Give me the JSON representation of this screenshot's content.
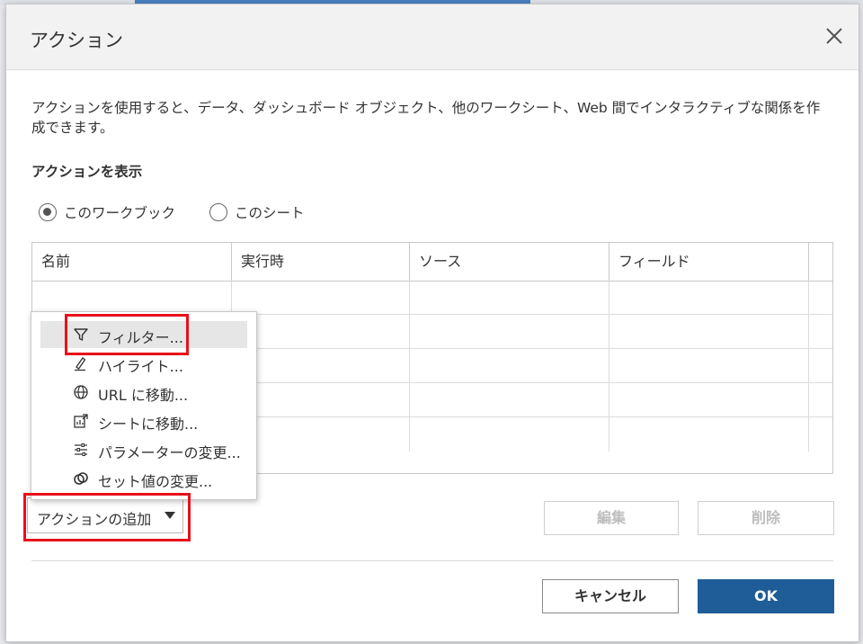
{
  "dialog": {
    "title": "アクション",
    "description": "アクションを使用すると、データ、ダッシュボード オブジェクト、他のワークシート、Web 間でインタラクティブな関係を作成できます。",
    "show_actions_label": "アクションを表示",
    "scope_options": [
      {
        "label": "このワークブック",
        "checked": true
      },
      {
        "label": "このシート",
        "checked": false
      }
    ]
  },
  "table": {
    "columns": [
      "名前",
      "実行時",
      "ソース",
      "フィールド"
    ],
    "rows": []
  },
  "add_action": {
    "label": "アクションの追加",
    "menu": [
      {
        "label": "フィルター...",
        "icon": "filter-icon",
        "highlighted": true
      },
      {
        "label": "ハイライト...",
        "icon": "highlight-pen-icon"
      },
      {
        "label": "URL に移動...",
        "icon": "globe-icon"
      },
      {
        "label": "シートに移動...",
        "icon": "go-to-sheet-icon"
      },
      {
        "label": "パラメーターの変更...",
        "icon": "sliders-icon"
      },
      {
        "label": "セット値の変更...",
        "icon": "set-values-icon"
      }
    ]
  },
  "buttons": {
    "edit": "編集",
    "delete": "削除",
    "cancel": "キャンセル",
    "ok": "OK"
  },
  "colors": {
    "ok_button": "#1f5d99",
    "highlight_box": "#e8101a",
    "menu_hover": "#e6e6e6"
  }
}
